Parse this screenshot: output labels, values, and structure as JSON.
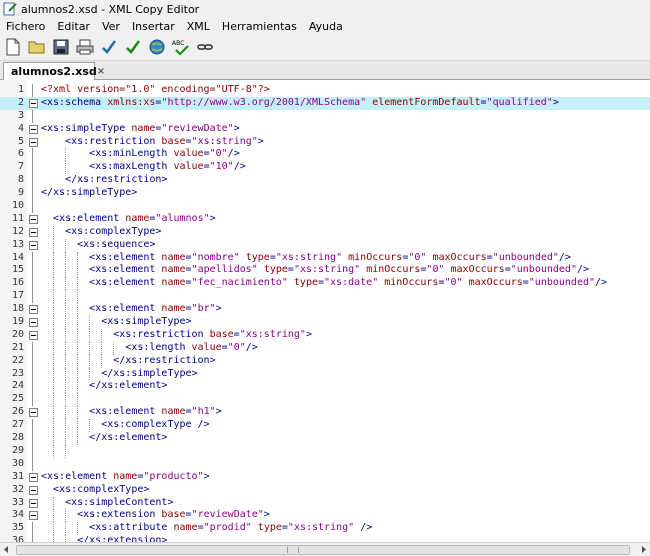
{
  "window": {
    "title": "alumnos2.xsd - XML Copy Editor"
  },
  "menu": [
    "Fichero",
    "Editar",
    "Ver",
    "Insertar",
    "XML",
    "Herramientas",
    "Ayuda"
  ],
  "toolbar": [
    {
      "icon": "new-document-icon"
    },
    {
      "icon": "open-folder-icon"
    },
    {
      "icon": "save-icon"
    },
    {
      "icon": "print-icon"
    },
    {
      "icon": "check-wellformed-icon"
    },
    {
      "icon": "validate-icon"
    },
    {
      "icon": "browser-globe-icon"
    },
    {
      "icon": "spellcheck-icon"
    },
    {
      "icon": "link-icon"
    }
  ],
  "tab": {
    "label": "alumnos2.xsd",
    "close": "×"
  },
  "editor": {
    "highlight_line": 2,
    "lines": [
      {
        "n": "1",
        "fold": false,
        "guides": [],
        "code": [
          {
            "c": "pi",
            "t": "<?xml version=\"1.0\" encoding=\"UTF-8\"?>"
          }
        ]
      },
      {
        "n": "2",
        "fold": true,
        "guides": [],
        "code": [
          {
            "c": "tg",
            "t": "<xs:schema "
          },
          {
            "c": "at",
            "t": "xmlns:xs"
          },
          {
            "c": "pl",
            "t": "="
          },
          {
            "c": "vl",
            "t": "\"http://www.w3.org/2001/XMLSchema\""
          },
          {
            "c": "pl",
            "t": " "
          },
          {
            "c": "at",
            "t": "elementFormDefault"
          },
          {
            "c": "pl",
            "t": "="
          },
          {
            "c": "vl",
            "t": "\"qualified\""
          },
          {
            "c": "tg",
            "t": ">"
          }
        ]
      },
      {
        "n": "3",
        "fold": false,
        "guides": [],
        "code": []
      },
      {
        "n": "4",
        "fold": true,
        "guides": [],
        "code": [
          {
            "c": "tg",
            "t": "<xs:simpleType "
          },
          {
            "c": "at",
            "t": "name"
          },
          {
            "c": "pl",
            "t": "="
          },
          {
            "c": "vl",
            "t": "\"reviewDate\""
          },
          {
            "c": "tg",
            "t": ">"
          }
        ]
      },
      {
        "n": "5",
        "fold": true,
        "guides": [],
        "code": [
          {
            "c": "pl",
            "t": "    "
          },
          {
            "c": "tg",
            "t": "<xs:restriction "
          },
          {
            "c": "at",
            "t": "base"
          },
          {
            "c": "pl",
            "t": "="
          },
          {
            "c": "vl",
            "t": "\"xs:string\""
          },
          {
            "c": "tg",
            "t": ">"
          }
        ]
      },
      {
        "n": "6",
        "fold": false,
        "guides": [
          4
        ],
        "code": [
          {
            "c": "pl",
            "t": "        "
          },
          {
            "c": "tg",
            "t": "<xs:minLength "
          },
          {
            "c": "at",
            "t": "value"
          },
          {
            "c": "pl",
            "t": "="
          },
          {
            "c": "vl",
            "t": "\"0\""
          },
          {
            "c": "tg",
            "t": "/>"
          }
        ]
      },
      {
        "n": "7",
        "fold": false,
        "guides": [
          4
        ],
        "code": [
          {
            "c": "pl",
            "t": "        "
          },
          {
            "c": "tg",
            "t": "<xs:maxLength "
          },
          {
            "c": "at",
            "t": "value"
          },
          {
            "c": "pl",
            "t": "="
          },
          {
            "c": "vl",
            "t": "\"10\""
          },
          {
            "c": "tg",
            "t": "/>"
          }
        ]
      },
      {
        "n": "8",
        "fold": false,
        "guides": [],
        "code": [
          {
            "c": "pl",
            "t": "    "
          },
          {
            "c": "tg",
            "t": "</xs:restriction>"
          }
        ]
      },
      {
        "n": "9",
        "fold": false,
        "guides": [],
        "code": [
          {
            "c": "tg",
            "t": "</xs:simpleType>"
          }
        ]
      },
      {
        "n": "10",
        "fold": false,
        "guides": [],
        "code": []
      },
      {
        "n": "11",
        "fold": true,
        "guides": [],
        "code": [
          {
            "c": "pl",
            "t": "  "
          },
          {
            "c": "tg",
            "t": "<xs:element "
          },
          {
            "c": "at",
            "t": "name"
          },
          {
            "c": "pl",
            "t": "="
          },
          {
            "c": "vl",
            "t": "\"alumnos\""
          },
          {
            "c": "tg",
            "t": ">"
          }
        ]
      },
      {
        "n": "12",
        "fold": true,
        "guides": [
          2
        ],
        "code": [
          {
            "c": "pl",
            "t": "    "
          },
          {
            "c": "tg",
            "t": "<xs:complexType>"
          }
        ]
      },
      {
        "n": "13",
        "fold": true,
        "guides": [
          2,
          4
        ],
        "code": [
          {
            "c": "pl",
            "t": "      "
          },
          {
            "c": "tg",
            "t": "<xs:sequence>"
          }
        ]
      },
      {
        "n": "14",
        "fold": false,
        "guides": [
          2,
          4,
          6
        ],
        "code": [
          {
            "c": "pl",
            "t": "        "
          },
          {
            "c": "tg",
            "t": "<xs:element "
          },
          {
            "c": "at",
            "t": "name"
          },
          {
            "c": "pl",
            "t": "="
          },
          {
            "c": "vl",
            "t": "\"nombre\""
          },
          {
            "c": "pl",
            "t": " "
          },
          {
            "c": "at",
            "t": "type"
          },
          {
            "c": "pl",
            "t": "="
          },
          {
            "c": "vl",
            "t": "\"xs:string\""
          },
          {
            "c": "pl",
            "t": " "
          },
          {
            "c": "at",
            "t": "minOccurs"
          },
          {
            "c": "pl",
            "t": "="
          },
          {
            "c": "vl",
            "t": "\"0\""
          },
          {
            "c": "pl",
            "t": " "
          },
          {
            "c": "at",
            "t": "maxOccurs"
          },
          {
            "c": "pl",
            "t": "="
          },
          {
            "c": "vl",
            "t": "\"unbounded\""
          },
          {
            "c": "tg",
            "t": "/>"
          }
        ]
      },
      {
        "n": "15",
        "fold": false,
        "guides": [
          2,
          4,
          6
        ],
        "code": [
          {
            "c": "pl",
            "t": "        "
          },
          {
            "c": "tg",
            "t": "<xs:element "
          },
          {
            "c": "at",
            "t": "name"
          },
          {
            "c": "pl",
            "t": "="
          },
          {
            "c": "vl",
            "t": "\"apellidos\""
          },
          {
            "c": "pl",
            "t": " "
          },
          {
            "c": "at",
            "t": "type"
          },
          {
            "c": "pl",
            "t": "="
          },
          {
            "c": "vl",
            "t": "\"xs:string\""
          },
          {
            "c": "pl",
            "t": " "
          },
          {
            "c": "at",
            "t": "minOccurs"
          },
          {
            "c": "pl",
            "t": "="
          },
          {
            "c": "vl",
            "t": "\"0\""
          },
          {
            "c": "pl",
            "t": " "
          },
          {
            "c": "at",
            "t": "maxOccurs"
          },
          {
            "c": "pl",
            "t": "="
          },
          {
            "c": "vl",
            "t": "\"unbounded\""
          },
          {
            "c": "tg",
            "t": "/>"
          }
        ]
      },
      {
        "n": "16",
        "fold": false,
        "guides": [
          2,
          4,
          6
        ],
        "code": [
          {
            "c": "pl",
            "t": "        "
          },
          {
            "c": "tg",
            "t": "<xs:element "
          },
          {
            "c": "at",
            "t": "name"
          },
          {
            "c": "pl",
            "t": "="
          },
          {
            "c": "vl",
            "t": "\"fec_nacimiento\""
          },
          {
            "c": "pl",
            "t": " "
          },
          {
            "c": "at",
            "t": "type"
          },
          {
            "c": "pl",
            "t": "="
          },
          {
            "c": "vl",
            "t": "\"xs:date\""
          },
          {
            "c": "pl",
            "t": " "
          },
          {
            "c": "at",
            "t": "minOccurs"
          },
          {
            "c": "pl",
            "t": "="
          },
          {
            "c": "vl",
            "t": "\"0\""
          },
          {
            "c": "pl",
            "t": " "
          },
          {
            "c": "at",
            "t": "maxOccurs"
          },
          {
            "c": "pl",
            "t": "="
          },
          {
            "c": "vl",
            "t": "\"unbounded\""
          },
          {
            "c": "tg",
            "t": "/>"
          }
        ]
      },
      {
        "n": "17",
        "fold": false,
        "guides": [
          2,
          4,
          6
        ],
        "code": []
      },
      {
        "n": "18",
        "fold": true,
        "guides": [
          2,
          4,
          6
        ],
        "code": [
          {
            "c": "pl",
            "t": "        "
          },
          {
            "c": "tg",
            "t": "<xs:element "
          },
          {
            "c": "at",
            "t": "name"
          },
          {
            "c": "pl",
            "t": "="
          },
          {
            "c": "vl",
            "t": "\"br\""
          },
          {
            "c": "tg",
            "t": ">"
          }
        ]
      },
      {
        "n": "19",
        "fold": true,
        "guides": [
          2,
          4,
          6,
          8
        ],
        "code": [
          {
            "c": "pl",
            "t": "          "
          },
          {
            "c": "tg",
            "t": "<xs:simpleType>"
          }
        ]
      },
      {
        "n": "20",
        "fold": true,
        "guides": [
          2,
          4,
          6,
          8,
          10
        ],
        "code": [
          {
            "c": "pl",
            "t": "            "
          },
          {
            "c": "tg",
            "t": "<xs:restriction "
          },
          {
            "c": "at",
            "t": "base"
          },
          {
            "c": "pl",
            "t": "="
          },
          {
            "c": "vl",
            "t": "\"xs:string\""
          },
          {
            "c": "tg",
            "t": ">"
          }
        ]
      },
      {
        "n": "21",
        "fold": false,
        "guides": [
          2,
          4,
          6,
          8,
          10,
          12
        ],
        "code": [
          {
            "c": "pl",
            "t": "              "
          },
          {
            "c": "tg",
            "t": "<xs:length "
          },
          {
            "c": "at",
            "t": "value"
          },
          {
            "c": "pl",
            "t": "="
          },
          {
            "c": "vl",
            "t": "\"0\""
          },
          {
            "c": "tg",
            "t": "/>"
          }
        ]
      },
      {
        "n": "22",
        "fold": false,
        "guides": [
          2,
          4,
          6,
          8,
          10
        ],
        "code": [
          {
            "c": "pl",
            "t": "            "
          },
          {
            "c": "tg",
            "t": "</xs:restriction>"
          }
        ]
      },
      {
        "n": "23",
        "fold": false,
        "guides": [
          2,
          4,
          6,
          8
        ],
        "code": [
          {
            "c": "pl",
            "t": "          "
          },
          {
            "c": "tg",
            "t": "</xs:simpleType>"
          }
        ]
      },
      {
        "n": "24",
        "fold": false,
        "guides": [
          2,
          4,
          6
        ],
        "code": [
          {
            "c": "pl",
            "t": "        "
          },
          {
            "c": "tg",
            "t": "</xs:element>"
          }
        ]
      },
      {
        "n": "25",
        "fold": false,
        "guides": [
          2,
          4,
          6
        ],
        "code": []
      },
      {
        "n": "26",
        "fold": true,
        "guides": [
          2,
          4,
          6
        ],
        "code": [
          {
            "c": "pl",
            "t": "        "
          },
          {
            "c": "tg",
            "t": "<xs:element "
          },
          {
            "c": "at",
            "t": "name"
          },
          {
            "c": "pl",
            "t": "="
          },
          {
            "c": "vl",
            "t": "\"h1\""
          },
          {
            "c": "tg",
            "t": ">"
          }
        ]
      },
      {
        "n": "27",
        "fold": false,
        "guides": [
          2,
          4,
          6,
          8
        ],
        "code": [
          {
            "c": "pl",
            "t": "          "
          },
          {
            "c": "tg",
            "t": "<xs:complexType />"
          }
        ]
      },
      {
        "n": "28",
        "fold": false,
        "guides": [
          2,
          4,
          6
        ],
        "code": [
          {
            "c": "pl",
            "t": "        "
          },
          {
            "c": "tg",
            "t": "</xs:element>"
          }
        ]
      },
      {
        "n": "29",
        "fold": false,
        "guides": [
          2,
          4
        ],
        "code": []
      },
      {
        "n": "30",
        "fold": false,
        "guides": [],
        "code": []
      },
      {
        "n": "31",
        "fold": true,
        "guides": [],
        "code": [
          {
            "c": "tg",
            "t": "<xs:element "
          },
          {
            "c": "at",
            "t": "name"
          },
          {
            "c": "pl",
            "t": "="
          },
          {
            "c": "vl",
            "t": "\"producto\""
          },
          {
            "c": "tg",
            "t": ">"
          }
        ]
      },
      {
        "n": "32",
        "fold": true,
        "guides": [],
        "code": [
          {
            "c": "pl",
            "t": "  "
          },
          {
            "c": "tg",
            "t": "<xs:complexType>"
          }
        ]
      },
      {
        "n": "33",
        "fold": true,
        "guides": [
          2
        ],
        "code": [
          {
            "c": "pl",
            "t": "    "
          },
          {
            "c": "tg",
            "t": "<xs:simpleContent>"
          }
        ]
      },
      {
        "n": "34",
        "fold": true,
        "guides": [
          2,
          4
        ],
        "code": [
          {
            "c": "pl",
            "t": "      "
          },
          {
            "c": "tg",
            "t": "<xs:extension "
          },
          {
            "c": "at",
            "t": "base"
          },
          {
            "c": "pl",
            "t": "="
          },
          {
            "c": "vl",
            "t": "\"reviewDate\""
          },
          {
            "c": "tg",
            "t": ">"
          }
        ]
      },
      {
        "n": "35",
        "fold": false,
        "guides": [
          2,
          4,
          6
        ],
        "code": [
          {
            "c": "pl",
            "t": "        "
          },
          {
            "c": "tg",
            "t": "<xs:attribute "
          },
          {
            "c": "at",
            "t": "name"
          },
          {
            "c": "pl",
            "t": "="
          },
          {
            "c": "vl",
            "t": "\"prodid\""
          },
          {
            "c": "pl",
            "t": " "
          },
          {
            "c": "at",
            "t": "type"
          },
          {
            "c": "pl",
            "t": "="
          },
          {
            "c": "vl",
            "t": "\"xs:string\""
          },
          {
            "c": "pl",
            "t": " "
          },
          {
            "c": "tg",
            "t": "/>"
          }
        ]
      },
      {
        "n": "36",
        "fold": false,
        "guides": [
          2,
          4
        ],
        "code": [
          {
            "c": "pl",
            "t": "      "
          },
          {
            "c": "tg",
            "t": "</xs:extension>"
          }
        ]
      }
    ]
  }
}
